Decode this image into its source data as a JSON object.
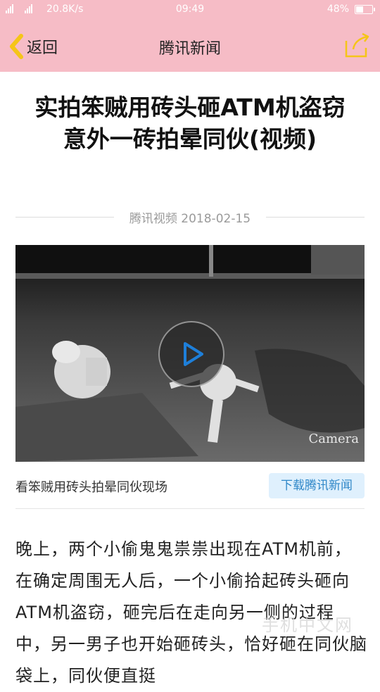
{
  "status": {
    "network": "20.8K/s",
    "time": "09:49",
    "battery": "48%",
    "battery_level": 0.48
  },
  "nav": {
    "back_label": "返回",
    "title": "腾讯新闻",
    "share_icon": "share-icon",
    "accent": "#f5c518",
    "bar_color": "#f6bcc6"
  },
  "article": {
    "title": "实拍笨贼用砖头砸ATM机盗窃 意外一砖拍晕同伙(视频)",
    "source_date": "腾讯视频 2018-02-15",
    "video_overlay_text": "Camera",
    "caption": "看笨贼用砖头拍晕同伙现场",
    "download_label": "下载腾讯新闻",
    "body": "晚上，两个小偷鬼鬼祟祟出现在ATM机前，在确定周围无人后，一个小偷拾起砖头砸向ATM机盗窃，砸完后在走向另一侧的过程中，另一男子也开始砸砖头，恰好砸在同伙脑袋上，同伙便直挺"
  },
  "watermark": "手机中文网"
}
